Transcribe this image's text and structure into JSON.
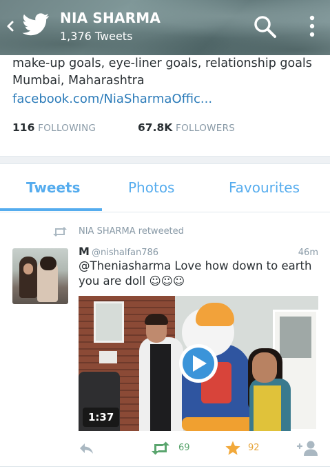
{
  "header": {
    "title": "NIA SHARMA",
    "tweet_count": "1,376 Tweets",
    "icons": {
      "back": "chevron-left-icon",
      "logo": "twitter-bird-icon",
      "search": "search-icon",
      "more": "more-vertical-icon"
    }
  },
  "profile": {
    "bio": "make-up goals, eye-liner goals, relationship goals",
    "location": "Mumbai, Maharashtra",
    "link": "facebook.com/NiaSharmaOffic...",
    "following_count": "116",
    "following_label": "FOLLOWING",
    "followers_count": "67.8K",
    "followers_label": "FOLLOWERS"
  },
  "tabs": [
    {
      "label": "Tweets",
      "active": true
    },
    {
      "label": "Photos",
      "active": false
    },
    {
      "label": "Favourites",
      "active": false
    }
  ],
  "tweet": {
    "retweeted_by": "NIA SHARMA retweeted",
    "name": "M",
    "handle": "@nishalfan786",
    "time": "46m",
    "text": "@Theniasharma Love how down to earth you are doll ☺☺☺",
    "media": {
      "type": "video",
      "duration": "1:37"
    },
    "retweets": "69",
    "favourites": "92"
  },
  "colors": {
    "accent": "#55acee",
    "link": "#2b7bb9",
    "retweet_green": "#5aa56e",
    "favourite_gold": "#e6a43a",
    "muted": "#8899a6"
  }
}
